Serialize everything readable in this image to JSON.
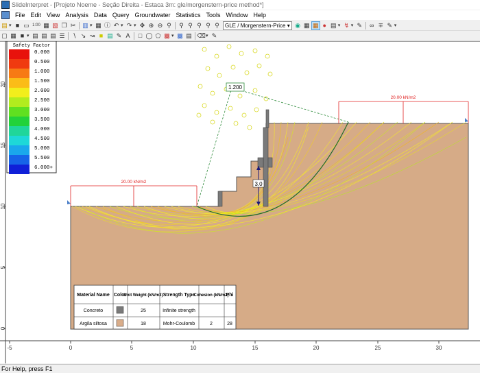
{
  "window": {
    "title": "SlideInterpret - [Projeto Noeme - Seção Direita - Estaca 3m: gle/morgenstern-price method*]"
  },
  "menu": [
    "File",
    "Edit",
    "View",
    "Analysis",
    "Data",
    "Query",
    "Groundwater",
    "Statistics",
    "Tools",
    "Window",
    "Help"
  ],
  "toolbar": {
    "scale_label": "1:00",
    "analysis_method": "GLE / Morgenstern-Price"
  },
  "legend": {
    "title": "Safety Factor",
    "items": [
      {
        "label": "0.000",
        "color": "#e8120c"
      },
      {
        "label": "0.500",
        "color": "#f03a10"
      },
      {
        "label": "1.000",
        "color": "#f77a14"
      },
      {
        "label": "1.500",
        "color": "#fbbc18"
      },
      {
        "label": "2.000",
        "color": "#f2ee1c"
      },
      {
        "label": "2.500",
        "color": "#b2ec1e"
      },
      {
        "label": "3.000",
        "color": "#60e020"
      },
      {
        "label": "3.500",
        "color": "#22d23a"
      },
      {
        "label": "4.000",
        "color": "#20d69a"
      },
      {
        "label": "4.500",
        "color": "#1ed8d8"
      },
      {
        "label": "5.000",
        "color": "#1aa8ec"
      },
      {
        "label": "5.500",
        "color": "#1664e8"
      },
      {
        "label": "6.000+",
        "color": "#1020d8"
      }
    ]
  },
  "model": {
    "min_fs_label": "1.200",
    "dim_label": "3.0",
    "load_left_label": "20.00 kN/m2",
    "load_right_label": "20.00 kN/m2",
    "x_ticks": [
      "-5",
      "0",
      "5",
      "10",
      "15",
      "20",
      "25",
      "30"
    ],
    "y_ticks": [
      "0",
      "5",
      "10",
      "15",
      "20"
    ]
  },
  "materials_table": {
    "headers": [
      "Material Name",
      "Color",
      "Unit Weight (kN/m3)",
      "Strength Type",
      "Cohesion (kN/m2)",
      "Phi"
    ],
    "rows": [
      {
        "name": "Concreto",
        "color": "#7a7a7a",
        "unit_weight": "25",
        "strength": "Infinite strength",
        "cohesion": "",
        "phi": ""
      },
      {
        "name": "Argila siltosa",
        "color": "#d9ad8a",
        "unit_weight": "18",
        "strength": "Mohr-Coulomb",
        "cohesion": "2",
        "phi": "28"
      }
    ]
  },
  "statusbar": {
    "text": "For Help, press F1"
  }
}
